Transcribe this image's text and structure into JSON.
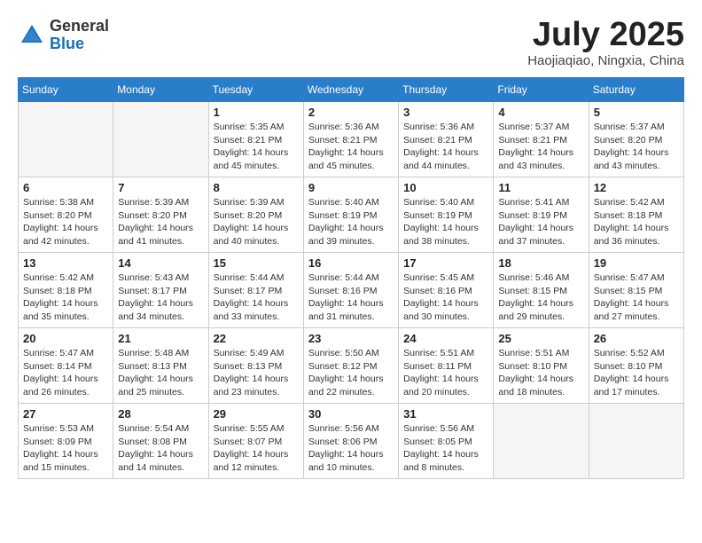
{
  "header": {
    "logo_line1": "General",
    "logo_line2": "Blue",
    "month": "July 2025",
    "location": "Haojiaqiao, Ningxia, China"
  },
  "days_of_week": [
    "Sunday",
    "Monday",
    "Tuesday",
    "Wednesday",
    "Thursday",
    "Friday",
    "Saturday"
  ],
  "weeks": [
    [
      {
        "day": "",
        "info": ""
      },
      {
        "day": "",
        "info": ""
      },
      {
        "day": "1",
        "info": "Sunrise: 5:35 AM\nSunset: 8:21 PM\nDaylight: 14 hours\nand 45 minutes."
      },
      {
        "day": "2",
        "info": "Sunrise: 5:36 AM\nSunset: 8:21 PM\nDaylight: 14 hours\nand 45 minutes."
      },
      {
        "day": "3",
        "info": "Sunrise: 5:36 AM\nSunset: 8:21 PM\nDaylight: 14 hours\nand 44 minutes."
      },
      {
        "day": "4",
        "info": "Sunrise: 5:37 AM\nSunset: 8:21 PM\nDaylight: 14 hours\nand 43 minutes."
      },
      {
        "day": "5",
        "info": "Sunrise: 5:37 AM\nSunset: 8:20 PM\nDaylight: 14 hours\nand 43 minutes."
      }
    ],
    [
      {
        "day": "6",
        "info": "Sunrise: 5:38 AM\nSunset: 8:20 PM\nDaylight: 14 hours\nand 42 minutes."
      },
      {
        "day": "7",
        "info": "Sunrise: 5:39 AM\nSunset: 8:20 PM\nDaylight: 14 hours\nand 41 minutes."
      },
      {
        "day": "8",
        "info": "Sunrise: 5:39 AM\nSunset: 8:20 PM\nDaylight: 14 hours\nand 40 minutes."
      },
      {
        "day": "9",
        "info": "Sunrise: 5:40 AM\nSunset: 8:19 PM\nDaylight: 14 hours\nand 39 minutes."
      },
      {
        "day": "10",
        "info": "Sunrise: 5:40 AM\nSunset: 8:19 PM\nDaylight: 14 hours\nand 38 minutes."
      },
      {
        "day": "11",
        "info": "Sunrise: 5:41 AM\nSunset: 8:19 PM\nDaylight: 14 hours\nand 37 minutes."
      },
      {
        "day": "12",
        "info": "Sunrise: 5:42 AM\nSunset: 8:18 PM\nDaylight: 14 hours\nand 36 minutes."
      }
    ],
    [
      {
        "day": "13",
        "info": "Sunrise: 5:42 AM\nSunset: 8:18 PM\nDaylight: 14 hours\nand 35 minutes."
      },
      {
        "day": "14",
        "info": "Sunrise: 5:43 AM\nSunset: 8:17 PM\nDaylight: 14 hours\nand 34 minutes."
      },
      {
        "day": "15",
        "info": "Sunrise: 5:44 AM\nSunset: 8:17 PM\nDaylight: 14 hours\nand 33 minutes."
      },
      {
        "day": "16",
        "info": "Sunrise: 5:44 AM\nSunset: 8:16 PM\nDaylight: 14 hours\nand 31 minutes."
      },
      {
        "day": "17",
        "info": "Sunrise: 5:45 AM\nSunset: 8:16 PM\nDaylight: 14 hours\nand 30 minutes."
      },
      {
        "day": "18",
        "info": "Sunrise: 5:46 AM\nSunset: 8:15 PM\nDaylight: 14 hours\nand 29 minutes."
      },
      {
        "day": "19",
        "info": "Sunrise: 5:47 AM\nSunset: 8:15 PM\nDaylight: 14 hours\nand 27 minutes."
      }
    ],
    [
      {
        "day": "20",
        "info": "Sunrise: 5:47 AM\nSunset: 8:14 PM\nDaylight: 14 hours\nand 26 minutes."
      },
      {
        "day": "21",
        "info": "Sunrise: 5:48 AM\nSunset: 8:13 PM\nDaylight: 14 hours\nand 25 minutes."
      },
      {
        "day": "22",
        "info": "Sunrise: 5:49 AM\nSunset: 8:13 PM\nDaylight: 14 hours\nand 23 minutes."
      },
      {
        "day": "23",
        "info": "Sunrise: 5:50 AM\nSunset: 8:12 PM\nDaylight: 14 hours\nand 22 minutes."
      },
      {
        "day": "24",
        "info": "Sunrise: 5:51 AM\nSunset: 8:11 PM\nDaylight: 14 hours\nand 20 minutes."
      },
      {
        "day": "25",
        "info": "Sunrise: 5:51 AM\nSunset: 8:10 PM\nDaylight: 14 hours\nand 18 minutes."
      },
      {
        "day": "26",
        "info": "Sunrise: 5:52 AM\nSunset: 8:10 PM\nDaylight: 14 hours\nand 17 minutes."
      }
    ],
    [
      {
        "day": "27",
        "info": "Sunrise: 5:53 AM\nSunset: 8:09 PM\nDaylight: 14 hours\nand 15 minutes."
      },
      {
        "day": "28",
        "info": "Sunrise: 5:54 AM\nSunset: 8:08 PM\nDaylight: 14 hours\nand 14 minutes."
      },
      {
        "day": "29",
        "info": "Sunrise: 5:55 AM\nSunset: 8:07 PM\nDaylight: 14 hours\nand 12 minutes."
      },
      {
        "day": "30",
        "info": "Sunrise: 5:56 AM\nSunset: 8:06 PM\nDaylight: 14 hours\nand 10 minutes."
      },
      {
        "day": "31",
        "info": "Sunrise: 5:56 AM\nSunset: 8:05 PM\nDaylight: 14 hours\nand 8 minutes."
      },
      {
        "day": "",
        "info": ""
      },
      {
        "day": "",
        "info": ""
      }
    ]
  ]
}
